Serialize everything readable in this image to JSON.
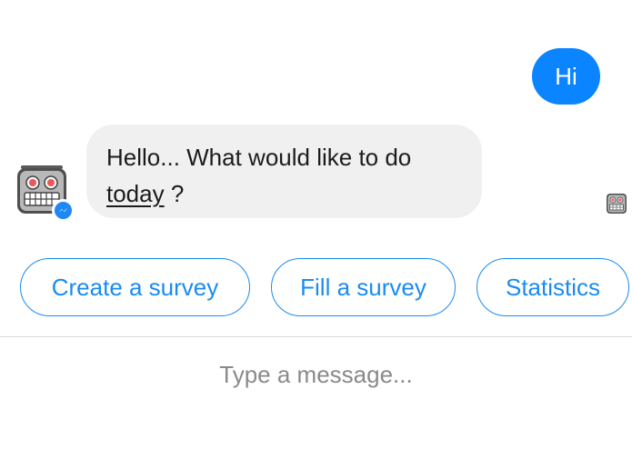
{
  "conversation": {
    "outgoing_message": "Hi",
    "incoming_message": {
      "text_line1": "Hello... What would like to do",
      "text_underlined": "today",
      "text_suffix": " ?"
    },
    "bot_avatar_icon": "robot-icon",
    "badge_icon": "messenger-icon",
    "read_receipt_icon": "robot-icon"
  },
  "quick_replies": [
    {
      "label": "Create a survey"
    },
    {
      "label": "Fill a survey"
    },
    {
      "label": "Statistics"
    }
  ],
  "composer": {
    "placeholder": "Type a message..."
  },
  "colors": {
    "accent": "#0a84ff",
    "quick_reply": "#1a8cf0",
    "incoming_bubble": "#f1f0f0"
  }
}
